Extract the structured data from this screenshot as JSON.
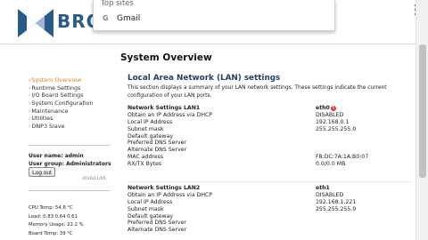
{
  "colors": {
    "brand_blue": "#2a5b87",
    "nav_active": "#d0831a",
    "section_title": "#1f3f6b",
    "status_error": "#d23b2a"
  },
  "header": {
    "logo_text": "BRO"
  },
  "browser_dropdown": {
    "heading": "Top sites",
    "item_icon": "google-icon",
    "item_icon_glyph": "G",
    "item_label": "Gmail"
  },
  "page_title": "System Overview",
  "sidebar": {
    "nav": [
      {
        "label": "System Overview",
        "active": true
      },
      {
        "label": "Runtime Settings",
        "active": false
      },
      {
        "label": "I/O Board Settings",
        "active": false
      },
      {
        "label": "System Configuration",
        "active": false
      },
      {
        "label": "Maintenance",
        "active": false
      },
      {
        "label": "Utilities",
        "active": false
      },
      {
        "label": "DNP3 Slave",
        "active": false
      }
    ],
    "user_name_line": "User name: admin",
    "user_group_line": "User group: Administrators",
    "logout_label": "Log out",
    "date": "2016/11/05",
    "stats": [
      "CPU Temp: 54.6 °C",
      "Load: 0.83  0.64  0.61",
      "Memory Usage: 22.2 %",
      "Board Temp: 39 °C"
    ]
  },
  "lan": {
    "title": "Local Area Network (LAN) settings",
    "description": "This section displays a summary of your LAN network settings. These settings indicate the current configuration of your LAN ports.",
    "blocks": [
      {
        "title": "Network Settings LAN1",
        "interface": "eth0",
        "status_glyph": "!",
        "rows": [
          {
            "label": "Obtain an IP Address via DHCP",
            "value": "DISABLED"
          },
          {
            "label": "Local IP Address",
            "value": "192.168.0.1"
          },
          {
            "label": "Subnet mask",
            "value": "255.255.255.0"
          },
          {
            "label": "Default gateway",
            "value": ""
          },
          {
            "label": "Preferred DNS Server",
            "value": ""
          },
          {
            "label": "Alternate DNS Server",
            "value": ""
          },
          {
            "label": "MAC address",
            "value": "F8:DC:7A:1A:B0:07"
          },
          {
            "label": "RX/TX Bytes",
            "value": "0.0/0.0 MB"
          }
        ]
      },
      {
        "title": "Network Settings LAN2",
        "interface": "eth1",
        "rows": [
          {
            "label": "Obtain an IP Address via DHCP",
            "value": "DISABLED"
          },
          {
            "label": "Local IP Address",
            "value": "192.168.1.221"
          },
          {
            "label": "Subnet mask",
            "value": "255.255.255.0"
          },
          {
            "label": "Default gateway",
            "value": ""
          },
          {
            "label": "Preferred DNS Server",
            "value": ""
          },
          {
            "label": "Alternate DNS Server",
            "value": ""
          }
        ]
      }
    ]
  }
}
